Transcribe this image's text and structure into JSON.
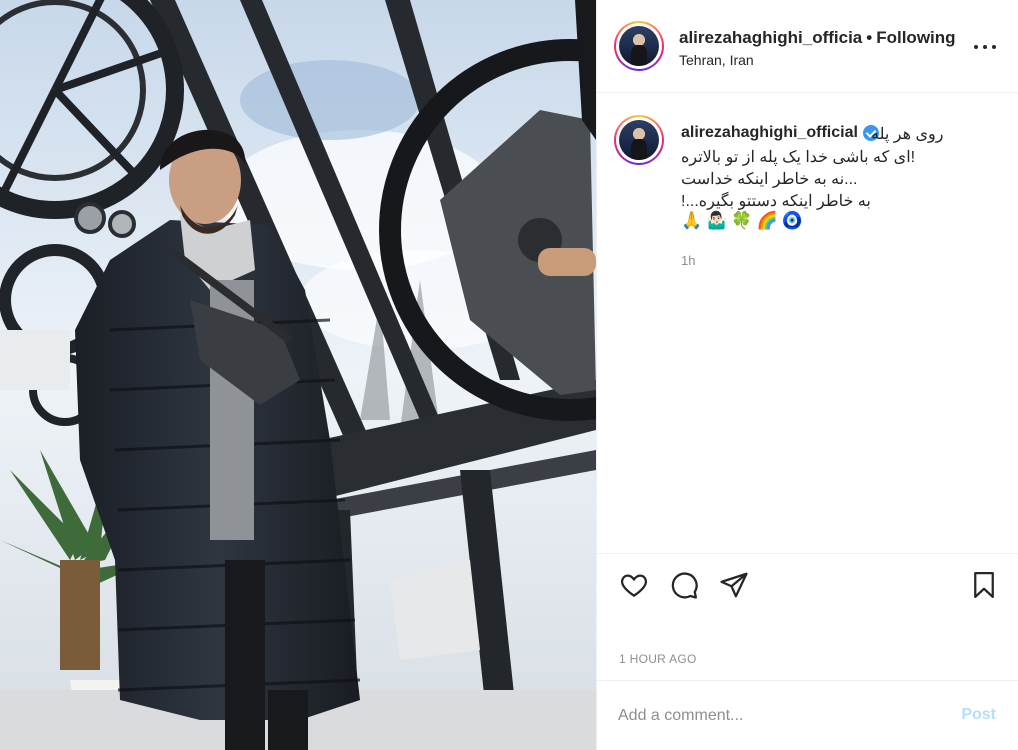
{
  "post": {
    "username": "alirezahaghighi_officia",
    "separator": "•",
    "follow_status": "Following",
    "location": "Tehran, Iran"
  },
  "caption": {
    "username": "alirezahaghighi_official",
    "lines": [
      "روی هر پله",
      "!ای که باشی خدا یک پله از تو بالاتره",
      "...نه به خاطر اینکه خداست",
      "به خاطر اینکه دستتو بگیره...!"
    ],
    "emojis": [
      "🙏",
      "🤷🏻‍♂️",
      "🍀",
      "🌈",
      "🧿"
    ],
    "time": "1h"
  },
  "actions": {
    "like_icon": "heart-icon",
    "comment_icon": "comment-icon",
    "share_icon": "paper-plane-icon",
    "save_icon": "bookmark-icon"
  },
  "posted_time": "1 HOUR AGO",
  "comment_box": {
    "placeholder": "Add a comment...",
    "post_label": "Post"
  },
  "colors": {
    "text": "#262626",
    "muted": "#8e8e8e",
    "verified": "#3897f0",
    "post_disabled": "#b2dffc"
  }
}
